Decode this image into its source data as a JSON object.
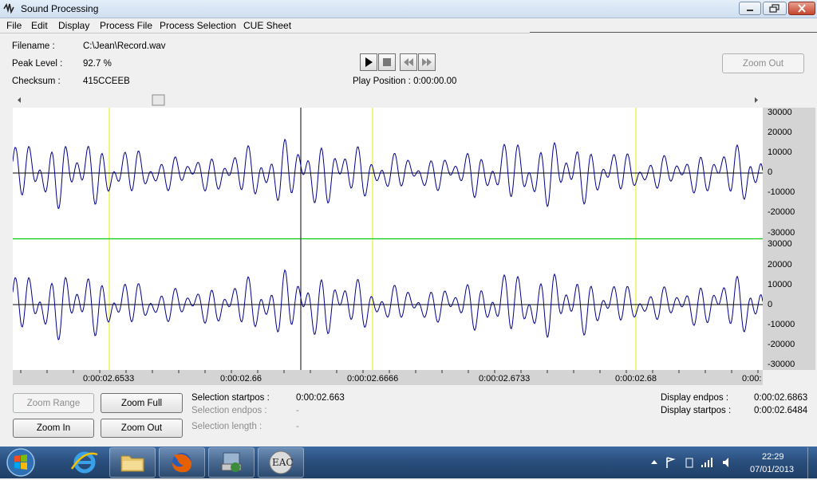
{
  "window": {
    "title": "Sound Processing"
  },
  "menu": [
    "File",
    "Edit",
    "Display",
    "Process File",
    "Process Selection",
    "CUE Sheet"
  ],
  "info": {
    "filename_label": "Filename :",
    "filename": "C:\\Jean\\Record.wav",
    "peak_label": "Peak Level :",
    "peak": "92.7 %",
    "checksum_label": "Checksum :",
    "checksum": "415CCEEB",
    "play_position": "Play Position : 0:00:00.00"
  },
  "buttons": {
    "zoom_out_top": "Zoom Out",
    "zoom_range": "Zoom Range",
    "zoom_full": "Zoom Full",
    "zoom_in": "Zoom In",
    "zoom_out": "Zoom Out"
  },
  "y_axis_ticks": [
    "30000",
    "20000",
    "10000",
    "0",
    "-10000",
    "-20000",
    "-30000"
  ],
  "time_axis": [
    "0:00:02.6533",
    "0:00:02.66",
    "0:00:02.6666",
    "0:00:02.6733",
    "0:00:02.68",
    "0:00:"
  ],
  "selection": {
    "start_label": "Selection startpos :",
    "start": "0:00:02.663",
    "end_label": "Selection endpos :",
    "end": "-",
    "length_label": "Selection length :",
    "length": "-"
  },
  "display": {
    "end_label": "Display endpos :",
    "end": "0:00:02.6863",
    "start_label": "Display startpos :",
    "start": "0:00:02.6484"
  },
  "taskbar": {
    "apps": [
      "start-orb",
      "internet-explorer",
      "file-explorer",
      "firefox",
      "installer",
      "EAC"
    ],
    "eac_label": "EAC",
    "time": "22:29",
    "date": "07/01/2013"
  },
  "colors": {
    "waveform": "#00008b",
    "marker": "#e8e800",
    "divider": "#00cc00",
    "cursor": "#000000"
  }
}
